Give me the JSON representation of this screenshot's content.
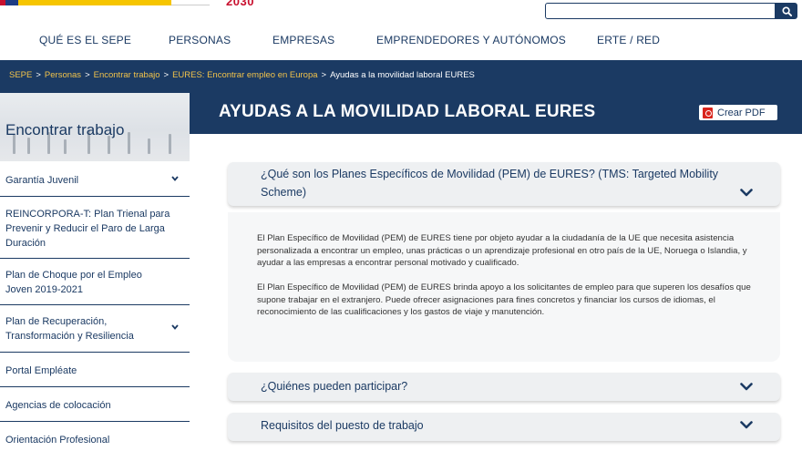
{
  "header": {
    "logo_text": "2030",
    "search": {
      "value": "",
      "placeholder": ""
    }
  },
  "nav": {
    "items": [
      "QUÉ ES EL SEPE",
      "PERSONAS",
      "EMPRESAS",
      "EMPRENDEDORES Y AUTÓNOMOS",
      "ERTE / RED"
    ]
  },
  "breadcrumb": {
    "items": [
      "SEPE",
      "Personas",
      "Encontrar trabajo",
      "EURES: Encontrar empleo en Europa",
      "Ayudas a la movilidad laboral EURES"
    ],
    "separator": ">"
  },
  "page": {
    "title": "AYUDAS A LA MOVILIDAD LABORAL EURES",
    "pdf_label": "Crear PDF"
  },
  "sidebar": {
    "title": "Encontrar trabajo",
    "items": [
      {
        "label": "Garantía Juvenil",
        "has_children": true
      },
      {
        "label": "REINCORPORA-T: Plan Trienal para Prevenir y Reducir el Paro de Larga Duración",
        "has_children": false
      },
      {
        "label": "Plan de Choque por el Empleo Joven 2019-2021",
        "has_children": false
      },
      {
        "label": "Plan de Recuperación, Transformación y Resiliencia",
        "has_children": true
      },
      {
        "label": "Portal Empléate",
        "has_children": false
      },
      {
        "label": "Agencias de colocación",
        "has_children": false
      },
      {
        "label": "Orientación Profesional",
        "has_children": false
      }
    ]
  },
  "accordion": [
    {
      "title": "¿Qué son los Planes Específicos de Movilidad (PEM) de EURES? (TMS: Targeted Mobility Scheme)",
      "expanded": true,
      "paragraphs": [
        "El Plan Específico de Movilidad (PEM) de EURES tiene por objeto ayudar a la ciudadanía de la UE que necesita asistencia personalizada a encontrar un empleo, unas prácticas o un aprendizaje profesional en otro país de la UE, Noruega o Islandia, y ayudar a las empresas a encontrar personal motivado y cualificado.",
        "El Plan Específico de Movilidad (PEM) de EURES brinda apoyo a los solicitantes de empleo para que superen los desafíos que supone trabajar en el extranjero. Puede ofrecer asignaciones para fines concretos y financiar los cursos de idiomas, el reconocimiento de las cualificaciones y los gastos de viaje y manutención."
      ]
    },
    {
      "title": "¿Quiénes pueden participar?",
      "expanded": false
    },
    {
      "title": "Requisitos del puesto de trabajo",
      "expanded": false
    }
  ],
  "icons": {
    "search": "search-icon",
    "pdf": "pdf-icon",
    "chevron": "chevron-down-icon"
  },
  "colors": {
    "brand_navy": "#1b3a63",
    "breadcrumb_link": "#f0c24b",
    "pdf_red": "#d9251d",
    "logo_red": "#c8102e"
  }
}
